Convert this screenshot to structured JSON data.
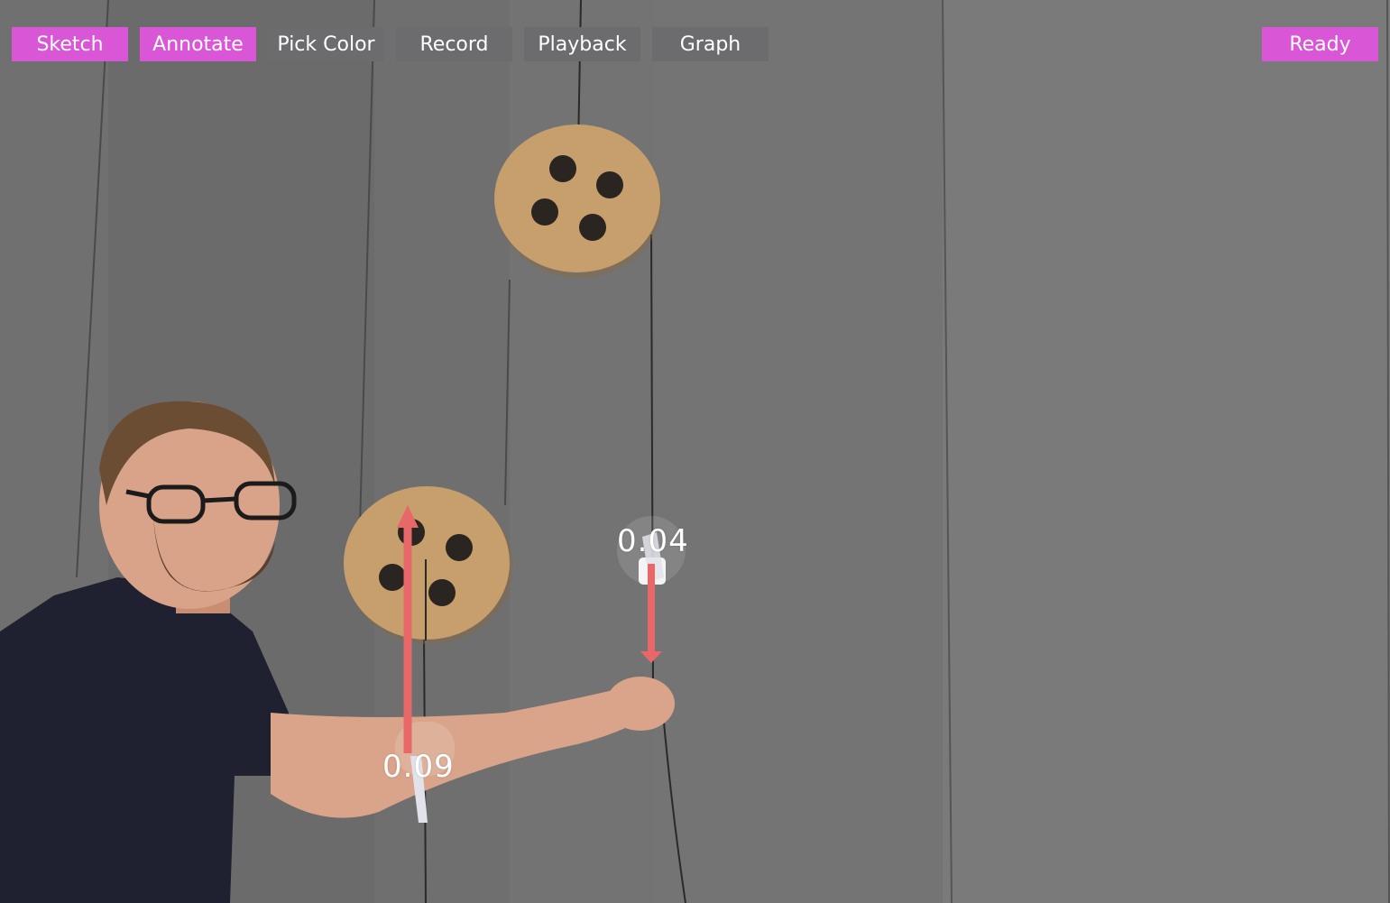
{
  "toolbar": {
    "sketch_label": "Sketch",
    "annotate_label": "Annotate",
    "pick_color_label": "Pick Color",
    "record_label": "Record",
    "playback_label": "Playback",
    "graph_label": "Graph",
    "ready_label": "Ready"
  },
  "vectors": {
    "left_value": "0.09",
    "right_value": "0.04"
  },
  "colors": {
    "accent": "#d957d6",
    "inactive": "#6c6c6e",
    "vector": "#e8686a"
  }
}
